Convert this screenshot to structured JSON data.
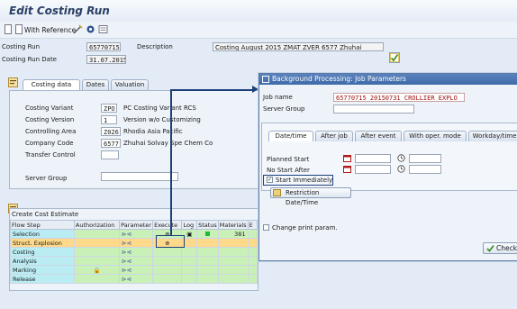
{
  "app": {
    "title": "Edit Costing Run"
  },
  "toolbar": {
    "with_reference": "With Reference"
  },
  "header": {
    "costing_run_label": "Costing Run",
    "costing_run_value": "65770715",
    "description_label": "Description",
    "description_value": "Costing August 2015 ZMAT ZVER 6577 Zhuhai",
    "costing_run_date_label": "Costing Run Date",
    "costing_run_date_value": "31.07.2015"
  },
  "tabs": [
    {
      "label": "Costing data"
    },
    {
      "label": "Dates"
    },
    {
      "label": "Valuation"
    }
  ],
  "costing_data": {
    "rows": [
      {
        "label": "Costing Variant",
        "code": "ZPO",
        "text": "PC Costing Variant  RCS"
      },
      {
        "label": "Costing Version",
        "code": "1",
        "text": "Version w/o Customizing"
      },
      {
        "label": "Controlling Area",
        "code": "Z026",
        "text": "Rhodia Asia Pacific"
      },
      {
        "label": "Company Code",
        "code": "6577",
        "text": "Zhuhai Solvay Spe Chem Co"
      },
      {
        "label": "Transfer Control",
        "code": "",
        "text": ""
      }
    ],
    "server_group_label": "Server Group",
    "server_group_value": ""
  },
  "estimate": {
    "title": "Create Cost Estimate",
    "columns": [
      "Flow Step",
      "Authorization",
      "Parameter",
      "Execute",
      "Log",
      "Status",
      "Materials",
      "E"
    ],
    "rows": [
      {
        "step": "Selection",
        "materials": "381"
      },
      {
        "step": "Struct. Explosion",
        "materials": ""
      },
      {
        "step": "Costing",
        "materials": ""
      },
      {
        "step": "Analysis",
        "materials": ""
      },
      {
        "step": "Marking",
        "materials": ""
      },
      {
        "step": "Release",
        "materials": ""
      }
    ]
  },
  "dialog": {
    "title": "Background Processing: Job Parameters",
    "job_name_label": "Job name",
    "job_name_value": "65770715_20150731_CROLLIER_EXPLO",
    "server_group_label": "Server Group",
    "server_group_value": "",
    "tabs": [
      {
        "label": "Date/time"
      },
      {
        "label": "After job"
      },
      {
        "label": "After event"
      },
      {
        "label": "With oper. mode"
      },
      {
        "label": "Workday/time"
      }
    ],
    "planned_start_label": "Planned Start",
    "no_start_after_label": "No Start After",
    "start_immediately_label": "Start Immediately",
    "restriction_label": "Restriction Date/Time",
    "change_print_label": "Change print param.",
    "check_button": "Check"
  },
  "colors": {
    "accent": "#1d3f7a",
    "dialog_title": "#3d6aa8",
    "row_highlight": "#ffd98a",
    "cell_green": "#c9f0b7",
    "cell_cyan": "#b9ecf3"
  }
}
